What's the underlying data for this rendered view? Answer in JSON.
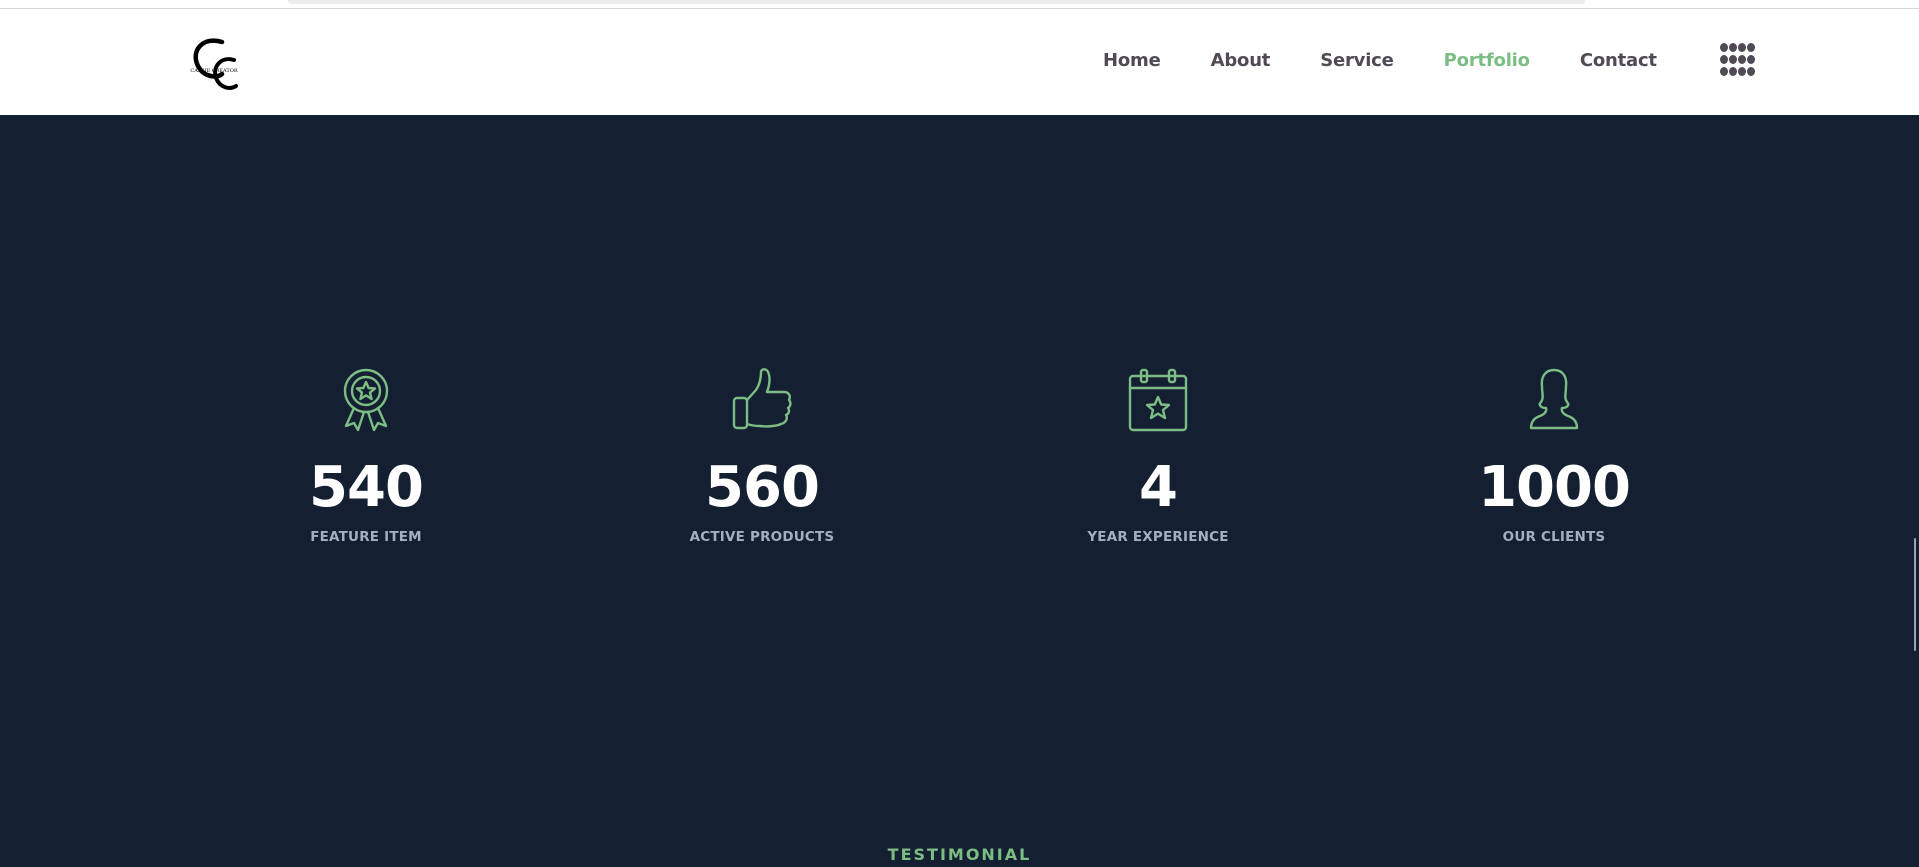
{
  "header": {
    "logo_text": "CASSIE CREATOR",
    "nav": [
      {
        "label": "Home",
        "active": false
      },
      {
        "label": "About",
        "active": false
      },
      {
        "label": "Service",
        "active": false
      },
      {
        "label": "Portfolio",
        "active": true
      },
      {
        "label": "Contact",
        "active": false
      }
    ],
    "menu_icon": "grid-dots-icon"
  },
  "stats": [
    {
      "icon": "award-ribbon-icon",
      "value": "540",
      "label": "FEATURE ITEM"
    },
    {
      "icon": "thumbs-up-icon",
      "value": "560",
      "label": "ACTIVE PRODUCTS"
    },
    {
      "icon": "calendar-star-icon",
      "value": "4",
      "label": "YEAR EXPERIENCE"
    },
    {
      "icon": "user-silhouette-icon",
      "value": "1000",
      "label": "OUR CLIENTS"
    }
  ],
  "next_section": {
    "label": "TESTIMONIAL"
  },
  "colors": {
    "accent": "#7cbd84",
    "background": "#151f32",
    "nav_text": "#4f4a55",
    "label_text": "#a3afc3"
  }
}
